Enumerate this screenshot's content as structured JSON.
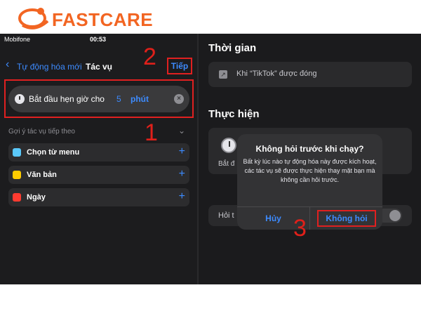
{
  "brand": {
    "logo_text": "FASTCARE",
    "accent": "#f26522"
  },
  "status_bar": {
    "carrier": "Mobifone",
    "time": "00:53",
    "right": "@ ▪"
  },
  "left": {
    "back_label": "Tự động hóa mới",
    "title": "Tác vụ",
    "next_label": "Tiếp",
    "action": {
      "text": "Bắt đầu hẹn giờ cho",
      "value": "5",
      "unit": "phút"
    },
    "suggest_heading": "Gợi ý tác vụ tiếp theo",
    "suggestions": [
      {
        "label": "Chọn từ menu",
        "icon": "menu-icon",
        "color": "#5ac8fa"
      },
      {
        "label": "Văn bản",
        "icon": "text-icon",
        "color": "#ffcc00"
      },
      {
        "label": "Ngày",
        "icon": "calendar-icon",
        "color": "#ff3b30"
      }
    ]
  },
  "right": {
    "section_time": "Thời gian",
    "trigger_text": "Khi “TikTok” được đóng",
    "section_run": "Thực hiện",
    "run_label": "Bắt đ",
    "ask_label": "Hỏi t",
    "alert": {
      "title": "Không hỏi trước khi chạy?",
      "message": "Bất kỳ lúc nào tự động hóa này được kích hoạt, các tác vụ sẽ được thực hiện thay mặt bạn mà không cần hỏi trước.",
      "cancel": "Hủy",
      "confirm": "Không hỏi"
    }
  },
  "annotations": {
    "step1": "1",
    "step2": "2",
    "step3": "3",
    "color": "#e0201a"
  }
}
